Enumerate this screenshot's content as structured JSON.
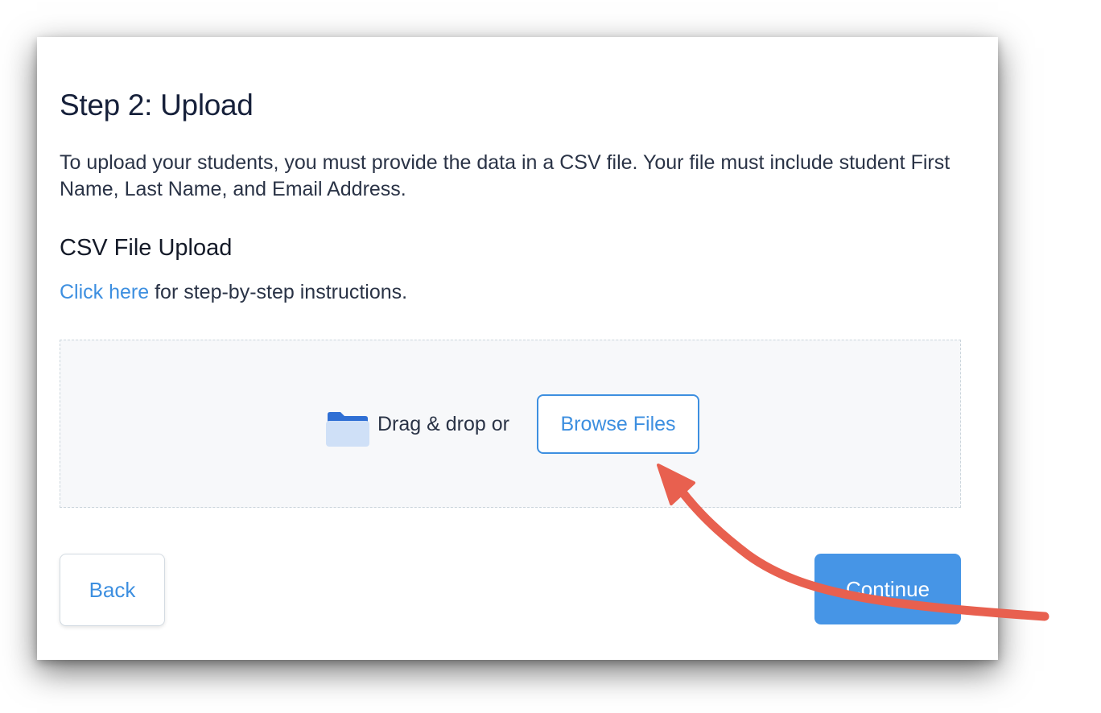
{
  "dialog": {
    "title": "Step 2: Upload",
    "description": "To upload your students, you must provide the data in a CSV file. Your file must include student First Name, Last Name, and Email Address.",
    "section_title": "CSV File Upload",
    "instructions_link": "Click here",
    "instructions_rest": " for step-by-step instructions."
  },
  "dropzone": {
    "icon": "folder-icon",
    "drag_text": "Drag & drop or",
    "browse_label": "Browse Files"
  },
  "footer": {
    "back_label": "Back",
    "continue_label": "Continue"
  },
  "annotation": {
    "icon": "curved-arrow-icon",
    "color": "#e8604f"
  },
  "colors": {
    "accent": "#3d8fe0",
    "primary_button": "#4695e6",
    "text_dark": "#16203a"
  }
}
